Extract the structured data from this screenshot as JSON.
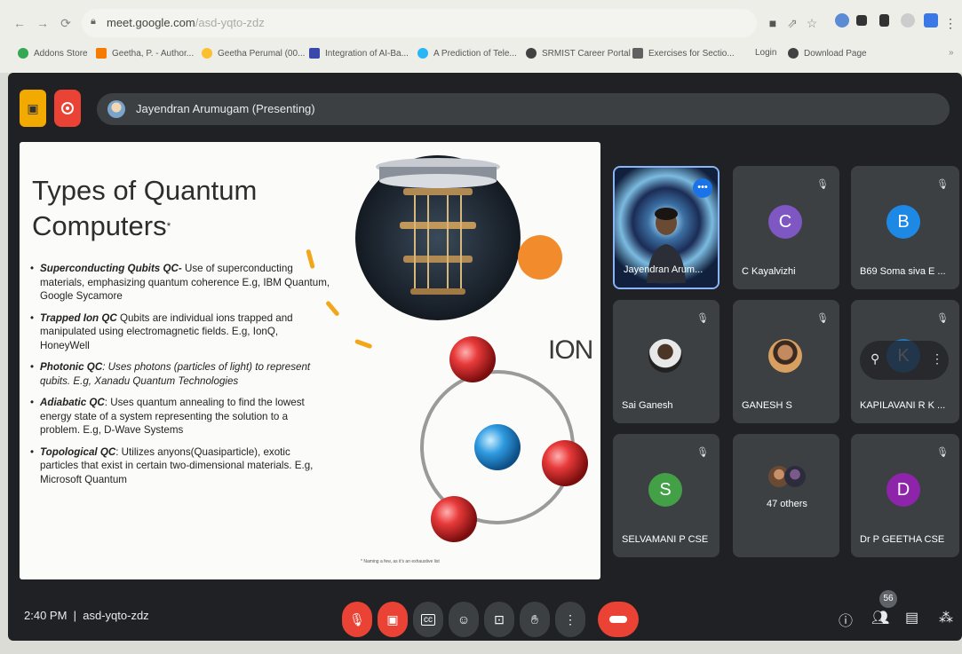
{
  "browser": {
    "url_domain": "meet.google.com",
    "url_path": "/asd-yqto-zdz",
    "bookmarks": [
      {
        "label": "Addons Store",
        "color": "#34a853"
      },
      {
        "label": "Geetha, P. - Author...",
        "color": "#f57c00"
      },
      {
        "label": "Geetha Perumal (00...",
        "color": "#fbc02d"
      },
      {
        "label": "Integration of AI-Ba...",
        "color": "#3949ab"
      },
      {
        "label": "A Prediction of Tele...",
        "color": "#29b6f6"
      },
      {
        "label": "SRMIST Career Portal",
        "color": "#424242"
      },
      {
        "label": "Exercises for Sectio...",
        "color": "#616161"
      },
      {
        "label": "Login",
        "color": ""
      },
      {
        "label": "Download Page",
        "color": "#424242"
      }
    ]
  },
  "meet": {
    "presenter_label": "Jayendran Arumugam (Presenting)",
    "time": "2:40 PM",
    "meeting_code": "asd-yqto-zdz",
    "participant_count": "56"
  },
  "slide": {
    "title_line1": "Types of Quantum",
    "title_line2": "Computers",
    "title_mark": "*",
    "ion_label": "ION",
    "footnote": "* Naming a few, as it's an exhaustive list",
    "bullets": [
      {
        "term": "Superconducting Qubits QC-",
        "text": " Use of superconducting materials, emphasizing quantum coherence E.g, IBM Quantum, Google Sycamore",
        "italic": false
      },
      {
        "term": "Trapped Ion QC",
        "text": " Qubits are individual ions trapped and manipulated using electromagnetic fields. E.g, IonQ, HoneyWell",
        "italic": false
      },
      {
        "term": "Photonic QC",
        "text": ": Uses photons (particles of light) to represent qubits. E.g, Xanadu Quantum Technologies",
        "italic": true
      },
      {
        "term": "Adiabatic QC",
        "text": ": Uses quantum annealing to find the lowest energy state of a system representing the solution to a problem. E.g, D-Wave Systems",
        "italic": false
      },
      {
        "term": "Topological QC",
        "text": ": Utilizes anyons(Quasiparticle), exotic particles that exist in certain two-dimensional materials. E.g, Microsoft Quantum",
        "italic": false
      }
    ]
  },
  "tiles": [
    {
      "name": "Jayendran Arum...",
      "type": "video"
    },
    {
      "name": "C Kayalvizhi",
      "initial": "C",
      "color": "#7e57c2"
    },
    {
      "name": "B69 Soma siva E ...",
      "initial": "B",
      "color": "#1e88e5"
    },
    {
      "name": "Sai Ganesh",
      "type": "photo"
    },
    {
      "name": "GANESH S",
      "type": "photo"
    },
    {
      "name": "KAPILAVANI R K ...",
      "initial": "K",
      "color": "#1e88e5"
    },
    {
      "name": "SELVAMANI P CSE",
      "initial": "S",
      "color": "#43a047"
    },
    {
      "name": "47 others",
      "type": "others"
    },
    {
      "name": "Dr P GEETHA CSE",
      "initial": "D",
      "color": "#8e24aa"
    }
  ]
}
